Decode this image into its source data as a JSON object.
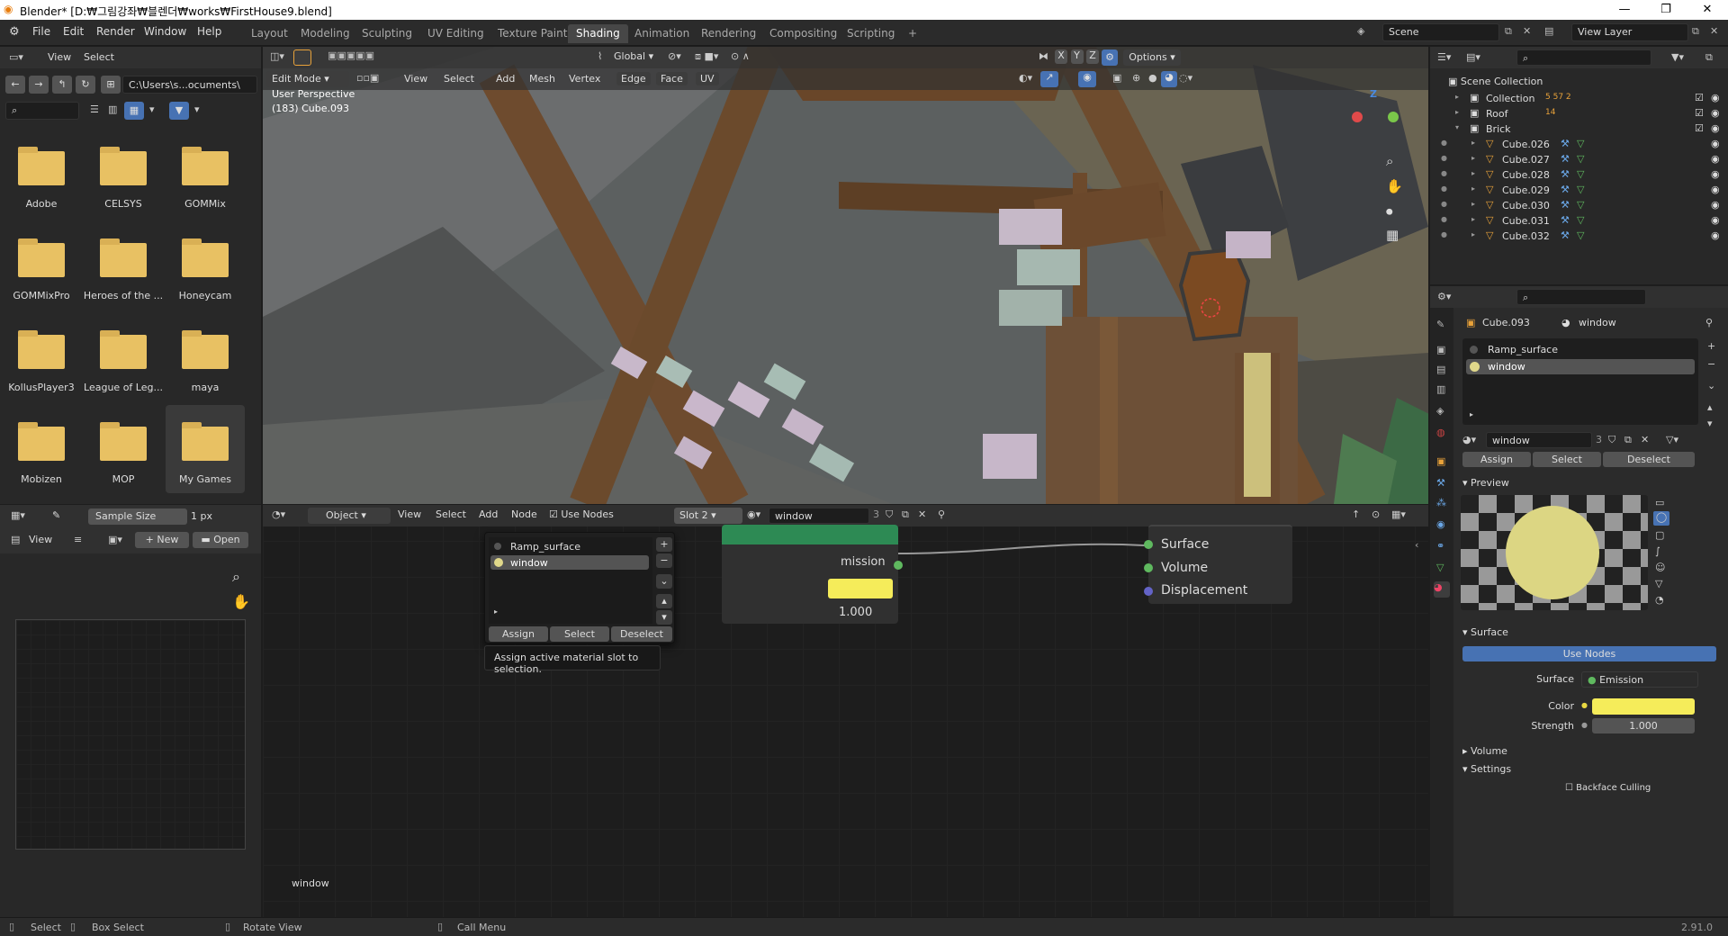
{
  "window": {
    "title": "Blender* [D:₩그림강좌₩블렌더₩works₩FirstHouse9.blend]",
    "minimize": "—",
    "maximize": "❐",
    "close": "✕"
  },
  "menu": [
    "File",
    "Edit",
    "Render",
    "Window",
    "Help"
  ],
  "workspaces": [
    "Layout",
    "Modeling",
    "Sculpting",
    "UV Editing",
    "Texture Paint",
    "Shading",
    "Animation",
    "Rendering",
    "Compositing",
    "Scripting",
    "+"
  ],
  "active_workspace": "Shading",
  "scene": {
    "name": "Scene",
    "view_layer": "View Layer"
  },
  "file_browser": {
    "view": "View",
    "select": "Select",
    "path": "C:\\Users\\s...ocuments\\",
    "folders": [
      "Adobe",
      "CELSYS",
      "GOMMix",
      "GOMMixPro",
      "Heroes of the ...",
      "Honeycam",
      "KollusPlayer3",
      "League of Leg...",
      "maya",
      "Mobizen",
      "MOP",
      "My Games"
    ]
  },
  "viewport": {
    "mode": "Edit Mode",
    "menus": [
      "View",
      "Select",
      "Add",
      "Mesh",
      "Vertex",
      "Edge",
      "Face",
      "UV"
    ],
    "orientation": "Global",
    "options": "Options",
    "info_line1": "User Perspective",
    "info_line2": "(183) Cube.093",
    "axes": {
      "x": "X",
      "y": "Y",
      "z": "Z"
    }
  },
  "image_editor": {
    "sample_size_label": "Sample Size",
    "sample_size_value": "1 px",
    "view": "View",
    "new": "New",
    "open": "Open"
  },
  "node_editor": {
    "object": "Object",
    "menus": [
      "View",
      "Select",
      "Add",
      "Node"
    ],
    "use_nodes": "Use Nodes",
    "slot": "Slot 2",
    "material": "window",
    "users": "3",
    "footer_label": "window",
    "emission_label": "mission",
    "strength_value": "1.000",
    "color_label": "Color",
    "strength_label": "Strength",
    "output_sockets": [
      "Surface",
      "Volume",
      "Displacement"
    ]
  },
  "slot_popup": {
    "slots": [
      "Ramp_surface",
      "window"
    ],
    "assign": "Assign",
    "select": "Select",
    "deselect": "Deselect",
    "tooltip": "Assign active material slot to selection."
  },
  "outliner": {
    "scene_collection": "Scene Collection",
    "items": [
      {
        "name": "Collection",
        "badges": "5  57  2"
      },
      {
        "name": "Roof",
        "badges": "14"
      },
      {
        "name": "Brick",
        "badges": ""
      },
      {
        "name": "Cube.026"
      },
      {
        "name": "Cube.027"
      },
      {
        "name": "Cube.028"
      },
      {
        "name": "Cube.029"
      },
      {
        "name": "Cube.030"
      },
      {
        "name": "Cube.031"
      },
      {
        "name": "Cube.032"
      }
    ]
  },
  "properties": {
    "object": "Cube.093",
    "material": "window",
    "slots": [
      "Ramp_surface",
      "window"
    ],
    "material_field": "window",
    "users": "3",
    "assign": "Assign",
    "select": "Select",
    "deselect": "Deselect",
    "preview_label": "Preview",
    "surface_label": "Surface",
    "use_nodes": "Use Nodes",
    "surface_prop": "Surface",
    "surface_value": "Emission",
    "color_label": "Color",
    "strength_label": "Strength",
    "strength_value": "1.000",
    "volume_label": "Volume",
    "settings_label": "Settings",
    "backface": "Backface Culling",
    "emission_color": "#f5ec5a"
  },
  "status_bar": {
    "select": "Select",
    "box_select": "Box Select",
    "rotate": "Rotate View",
    "call_menu": "Call Menu",
    "version": "2.91.0"
  }
}
